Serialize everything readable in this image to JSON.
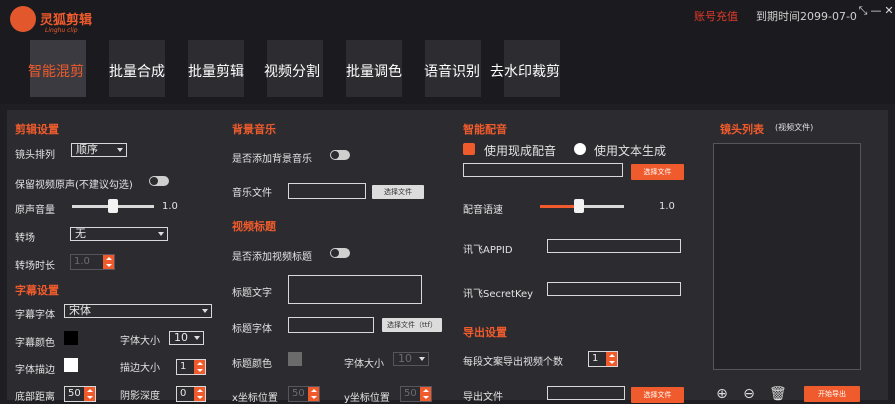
{
  "app": {
    "logo_title": "灵狐剪辑",
    "logo_subtitle": "Linghu clip",
    "recharge": "账号充值",
    "expire": "到期时间2099-07-0",
    "window_buttons": [
      "⤡",
      "—",
      "✕"
    ]
  },
  "tabs": [
    "智能混剪",
    "批量合成",
    "批量剪辑",
    "视频分割",
    "批量调色",
    "语音识别",
    "去水印裁剪"
  ],
  "edit": {
    "title": "剪辑设置",
    "shot_order_label": "镜头排列",
    "shot_order_value": "顺序",
    "keep_audio_label": "保留视频原声(不建议勾选)",
    "volume_label": "原声音量",
    "volume_value": "1.0",
    "transition_label": "转场",
    "transition_value": "无",
    "transition_duration_label": "转场时长",
    "transition_duration_value": "1.0"
  },
  "subtitle": {
    "title": "字幕设置",
    "font_label": "字幕字体",
    "font_value": "宋体",
    "color_label": "字幕颜色",
    "color": "#000000",
    "size_label": "字体大小",
    "size_value": "10",
    "stroke_label": "字体描边",
    "stroke_color": "#ffffff",
    "stroke_size_label": "描边大小",
    "stroke_size_value": "1",
    "bottom_label": "底部距离",
    "bottom_value": "50",
    "shadow_label": "阴影深度",
    "shadow_value": "0"
  },
  "bgm": {
    "title": "背景音乐",
    "add_label": "是否添加背景音乐",
    "file_label": "音乐文件",
    "choose_file": "选择文件"
  },
  "video_title": {
    "title": "视频标题",
    "add_label": "是否添加视频标题",
    "text_label": "标题文字",
    "font_label": "标题字体",
    "choose_font": "选择文件（ttf）",
    "color_label": "标题颜色",
    "title_color": "#6b6b6b",
    "size_label": "字体大小",
    "size_value": "10",
    "x_label": "x坐标位置",
    "x_value": "50",
    "y_label": "y坐标位置",
    "y_value": "50"
  },
  "dubbing": {
    "title": "智能配音",
    "use_existing": "使用现成配音",
    "use_text": "使用文本生成",
    "choose_file": "选择文件",
    "speed_label": "配音语速",
    "speed_value": "1.0",
    "appid_label": "讯飞APPID",
    "secret_label": "讯飞SecretKey"
  },
  "export": {
    "title": "导出设置",
    "count_label": "每段文案导出视频个数",
    "count_value": "1",
    "file_label": "导出文件",
    "choose_file": "选择文件"
  },
  "shots": {
    "title": "镜头列表",
    "subtitle": "(视频文件)",
    "add_icon": "⊕",
    "remove_icon": "⊖",
    "delete_icon": "🗑",
    "start": "开始导出"
  },
  "colors": {
    "accent": "#ef5b2c",
    "panel": "#2b2b30",
    "background": "#1f1f23"
  }
}
